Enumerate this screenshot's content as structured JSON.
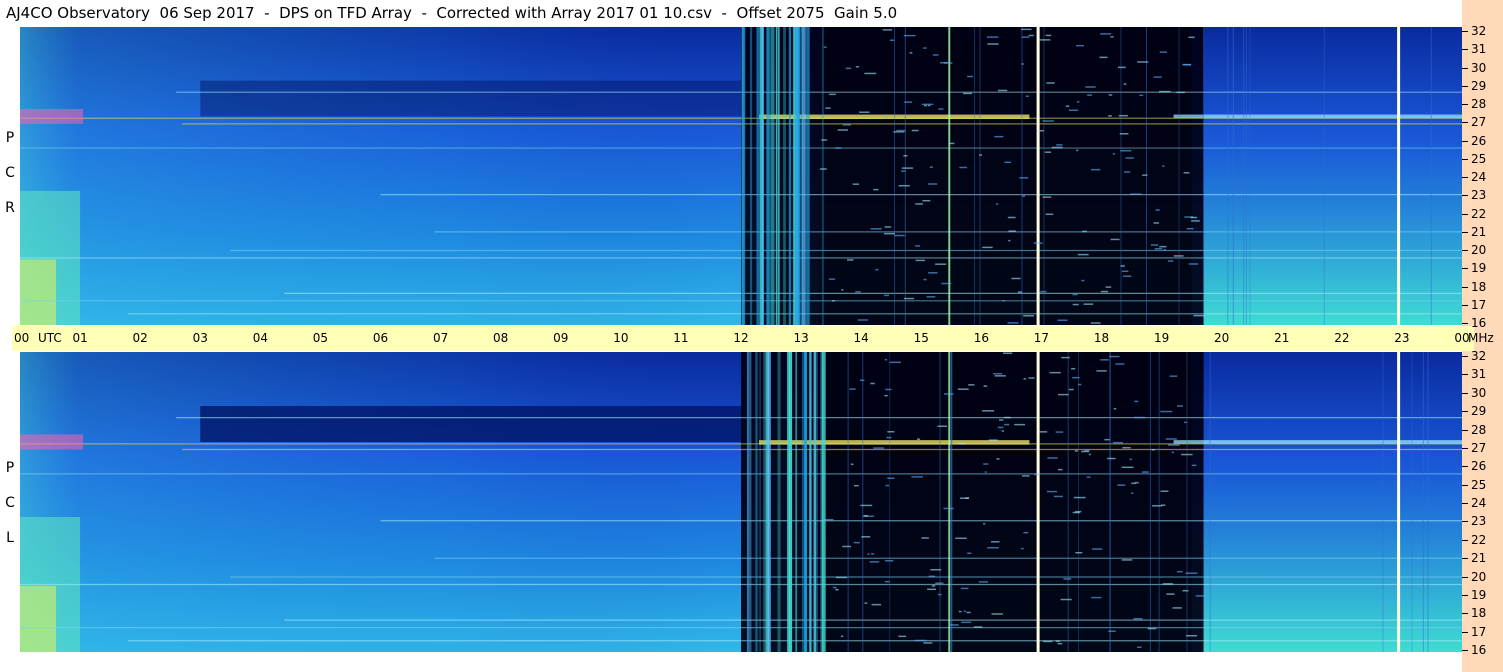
{
  "title": "AJ4CO Observatory  06 Sep 2017  -  DPS on TFD Array  -  Corrected with Array 2017 01 10.csv  -  Offset 2075  Gain 5.0",
  "chart_data": {
    "type": "heatmap",
    "title": "AJ4CO Observatory  06 Sep 2017  -  DPS on TFD Array  -  Corrected with Array 2017 01 10.csv  -  Offset 2075  Gain 5.0",
    "x_axis": {
      "label": "UTC",
      "ticks": [
        "00",
        "01",
        "02",
        "03",
        "04",
        "05",
        "06",
        "07",
        "08",
        "09",
        "10",
        "11",
        "12",
        "13",
        "14",
        "15",
        "16",
        "17",
        "18",
        "19",
        "20",
        "21",
        "22",
        "23",
        "00"
      ],
      "range_hours": [
        0,
        24
      ]
    },
    "y_axis": {
      "unit": "MHz",
      "range": [
        16,
        32
      ],
      "ticks": [
        "32",
        "31",
        "30",
        "29",
        "28",
        "27",
        "26",
        "25",
        "24",
        "23",
        "22",
        "21",
        "20",
        "19",
        "18",
        "17",
        "16"
      ]
    },
    "panels": [
      {
        "label": "R C P",
        "letters": [
          "R",
          "C",
          "P"
        ],
        "polarization": "Right circular"
      },
      {
        "label": "L C P",
        "letters": [
          "L",
          "C",
          "P"
        ],
        "polarization": "Left circular"
      }
    ],
    "colormap": [
      "#000014",
      "#0a2a9e",
      "#1a58d8",
      "#1ea8e8",
      "#40e0d0",
      "#c8f050",
      "#f0d020",
      "#ff40a0"
    ],
    "bright_vertical_lines_utc": [
      16.92,
      22.92
    ]
  }
}
